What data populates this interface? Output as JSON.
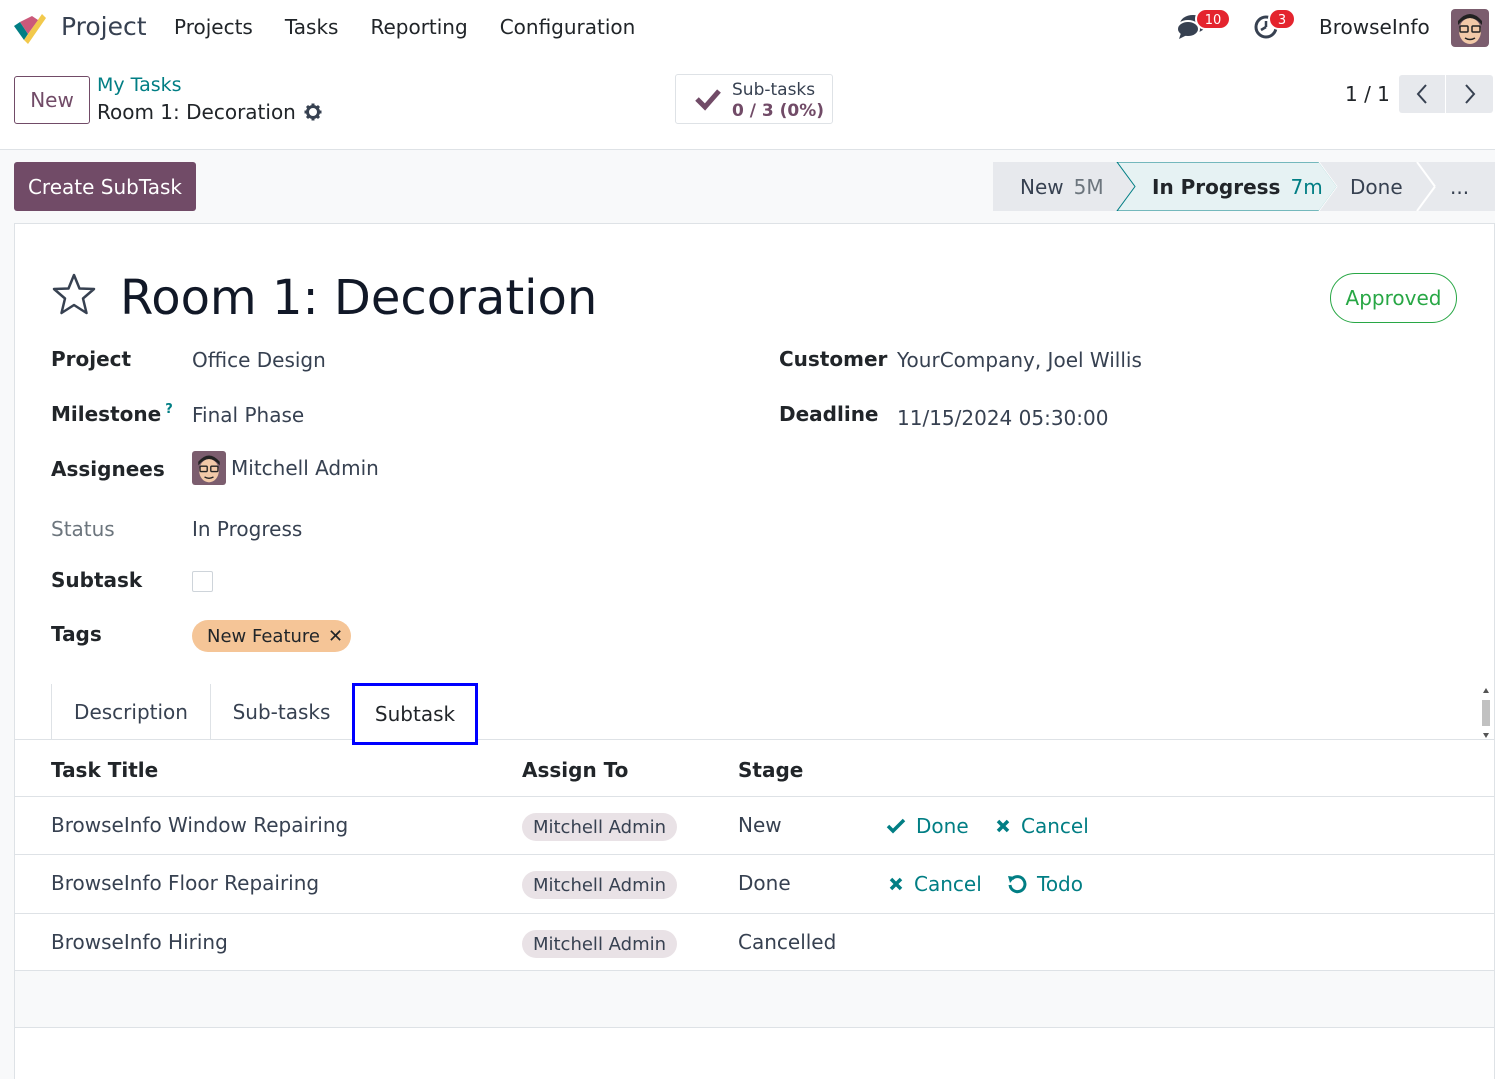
{
  "navbar": {
    "app_name": "Project",
    "menu": [
      "Projects",
      "Tasks",
      "Reporting",
      "Configuration"
    ],
    "chat_badge": "10",
    "activity_badge": "3",
    "company": "BrowseInfo"
  },
  "control_panel": {
    "new_label": "New",
    "breadcrumb_parent": "My Tasks",
    "breadcrumb_current": "Room 1: Decoration",
    "smart_button": {
      "label": "Sub-tasks",
      "value": "0 / 3 (0%)"
    },
    "pager": "1 / 1"
  },
  "actions": {
    "create_subtask": "Create SubTask"
  },
  "stages": [
    {
      "name": "New",
      "time": "5M",
      "active": false
    },
    {
      "name": "In Progress",
      "time": "7m",
      "active": true
    },
    {
      "name": "Done",
      "time": "",
      "active": false
    },
    {
      "name": "...",
      "time": "",
      "active": false
    }
  ],
  "form": {
    "title": "Room 1: Decoration",
    "approval_badge": "Approved",
    "fields": {
      "project_label": "Project",
      "project_value": "Office Design",
      "milestone_label": "Milestone",
      "milestone_help": "?",
      "milestone_value": "Final Phase",
      "assignees_label": "Assignees",
      "assignees_value": "Mitchell Admin",
      "status_label": "Status",
      "status_value": "In Progress",
      "subtask_label": "Subtask",
      "tags_label": "Tags",
      "tag_value": "New Feature",
      "customer_label": "Customer",
      "customer_value": "YourCompany, Joel Willis",
      "deadline_label": "Deadline",
      "deadline_value": "11/15/2024 05:30:00"
    }
  },
  "tabs": [
    "Description",
    "Sub-tasks",
    "Subtask"
  ],
  "subtask_table": {
    "headers": [
      "Task Title",
      "Assign To",
      "Stage"
    ],
    "rows": [
      {
        "title": "BrowseInfo Window Repairing",
        "assignee": "Mitchell Admin",
        "stage": "New",
        "action1": "Done",
        "action2": "Cancel"
      },
      {
        "title": "BrowseInfo Floor Repairing",
        "assignee": "Mitchell Admin",
        "stage": "Done",
        "action1": "Cancel",
        "action2": "Todo"
      },
      {
        "title": "BrowseInfo Hiring",
        "assignee": "Mitchell Admin",
        "stage": "Cancelled"
      }
    ]
  },
  "colors": {
    "brand": "#714b67",
    "accent": "#017e84",
    "approved": "#28a745",
    "badge": "#e4242e",
    "tag": "#f5c597"
  }
}
